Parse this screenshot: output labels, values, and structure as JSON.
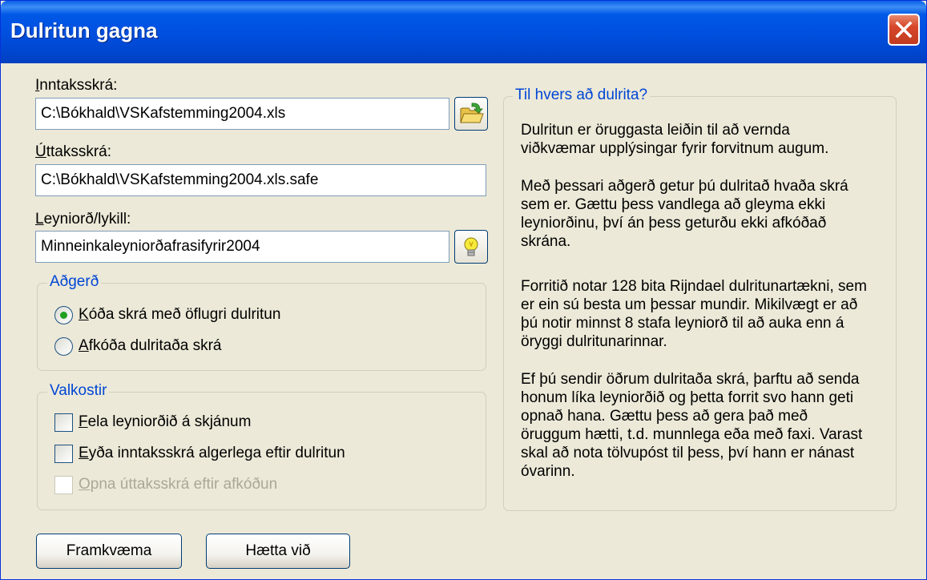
{
  "window": {
    "title": "Dulritun gagna"
  },
  "input_file": {
    "label_mnemonic": "I",
    "label_rest": "nntaksskrá:",
    "value": "C:\\Bókhald\\VSKafstemming2004.xls"
  },
  "output_file": {
    "label_mnemonic": "Ú",
    "label_rest": "ttaksskrá:",
    "value": "C:\\Bókhald\\VSKafstemming2004.xls.safe"
  },
  "password": {
    "label_mnemonic": "L",
    "label_rest": "eyniorð/lykill:",
    "value": "Minneinkaleyniorðafrasifyrir2004"
  },
  "action_group": {
    "title": "Aðgerð",
    "options": [
      {
        "mnemonic": "K",
        "rest": "óða skrá með öflugri dulritun",
        "selected": true
      },
      {
        "mnemonic": "A",
        "rest": "fkóða dulritaða skrá",
        "selected": false
      }
    ]
  },
  "options_group": {
    "title": "Valkostir",
    "options": [
      {
        "mnemonic": "F",
        "rest": "ela leyniorðið á skjánum",
        "checked": false,
        "enabled": true
      },
      {
        "mnemonic": "E",
        "rest": "yða inntaksskrá algerlega eftir dulritun",
        "checked": false,
        "enabled": true
      },
      {
        "mnemonic": "O",
        "rest": "pna úttaksskrá eftir afkóðun",
        "checked": false,
        "enabled": false
      }
    ]
  },
  "info": {
    "title": "Til hvers að dulrita?",
    "lines": [
      "Dulritun er öruggasta leiðin til að vernda",
      "viðkvæmar upplýsingar fyrir forvitnum augum.",
      "Með þessari aðgerð getur þú dulritað hvaða skrá",
      "sem er.  Gættu þess vandlega að gleyma ekki",
      "leyniorðinu,  því án þess geturðu ekki afkóðað",
      "skrána.",
      "Forritið notar 128 bita Rijndael dulritunartækni, sem",
      "er ein sú besta um þessar mundir.  Mikilvægt er að",
      "þú notir minnst 8 stafa leyniorð til að auka enn á",
      "öryggi dulritunarinnar.",
      "Ef þú sendir öðrum dulritaða skrá, þarftu að senda",
      "honum líka leyniorðið og þetta forrit svo hann geti",
      "opnað hana.  Gættu þess að gera það með",
      "öruggum hætti, t.d. munnlega eða með faxi.  Varast",
      "skal að nota tölvupóst til þess, því hann er nánast",
      "óvarinn."
    ]
  },
  "buttons": {
    "execute": "Framkvæma",
    "cancel": "Hætta við"
  },
  "icons": {
    "open": "folder-open-icon",
    "hint": "lightbulb-icon",
    "close": "close-icon"
  },
  "colors": {
    "title_bar": "#0054e3",
    "group_title": "#0046d5",
    "dialog_bg": "#ece9d8",
    "close_button": "#d7462a"
  }
}
